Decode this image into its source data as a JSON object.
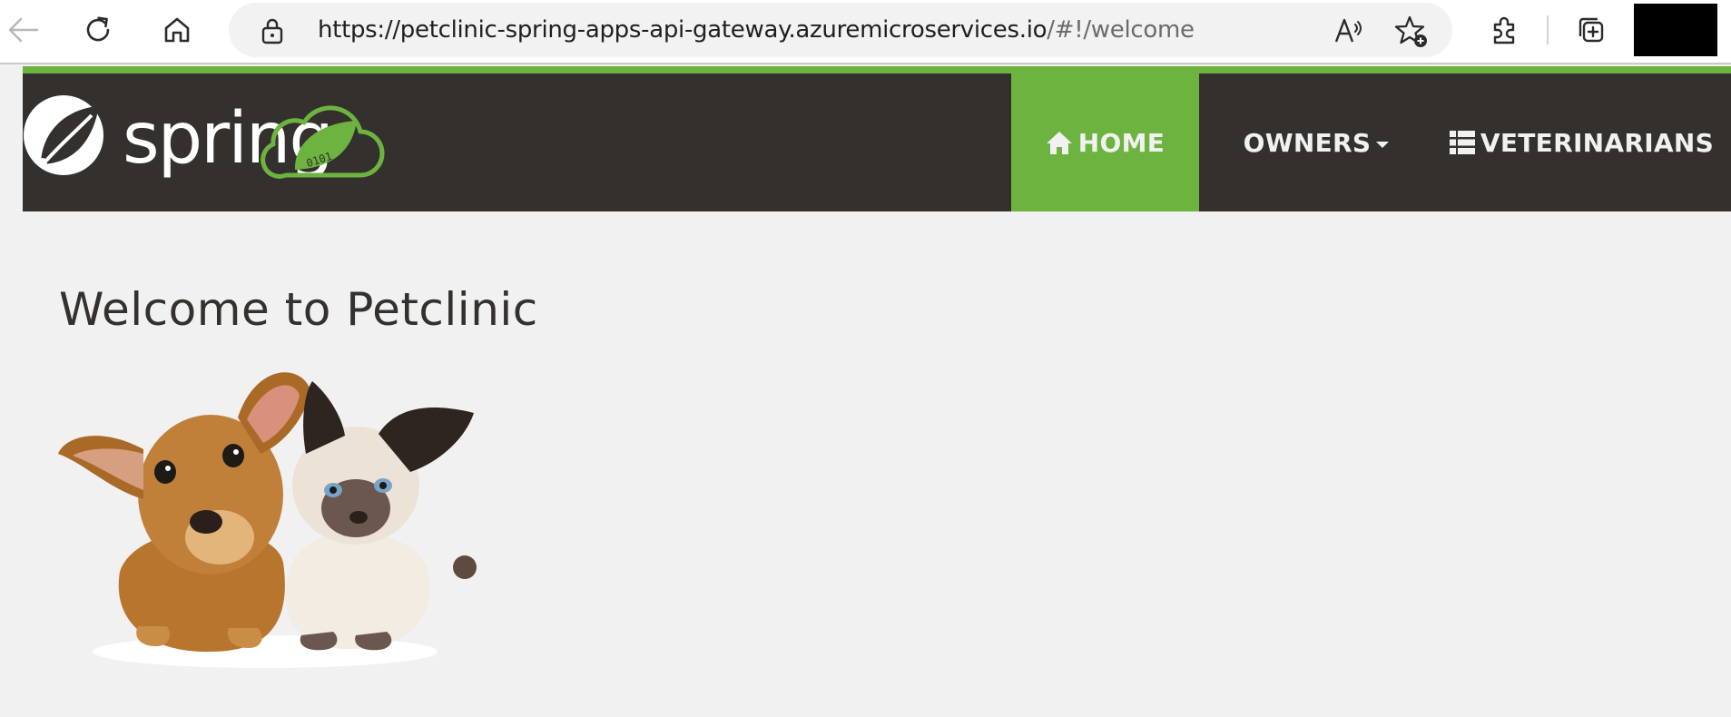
{
  "browser": {
    "url_main": "https://petclinic-spring-apps-api-gateway.azuremicroservices.io",
    "url_path": "/#!/welcome",
    "icons": [
      "back-arrow-icon",
      "refresh-icon",
      "home-icon",
      "lock-icon",
      "read-aloud-icon",
      "favorite-add-icon",
      "extensions-icon",
      "collections-icon"
    ]
  },
  "navbar": {
    "logo_text": "spring",
    "logo_binary": "0101",
    "items": [
      {
        "label": "HOME",
        "icon": "home-icon",
        "active": true
      },
      {
        "label": "OWNERS",
        "icon": "caret-down-icon",
        "active": false
      },
      {
        "label": "VETERINARIANS",
        "icon": "list-icon",
        "active": false
      }
    ]
  },
  "main": {
    "title": "Welcome to Petclinic",
    "image": "puppy-and-kitten"
  },
  "colors": {
    "brand_green": "#6db33f",
    "nav_bg": "#34302d",
    "page_bg": "#f1f1f1"
  }
}
